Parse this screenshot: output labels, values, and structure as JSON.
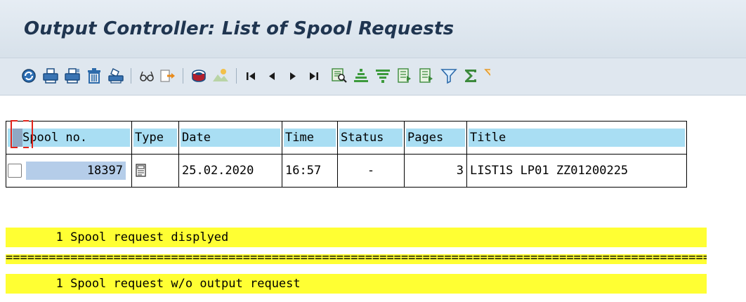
{
  "header": {
    "title": "Output Controller: List of Spool Requests"
  },
  "toolbar": {
    "buttons": [
      "refresh-icon",
      "print-icon",
      "print-with-changes-icon",
      "delete-icon",
      "print-directly-icon",
      "display-contents-icon",
      "output-requests-icon",
      "attributes-icon",
      "background-icon",
      "first-page-icon",
      "previous-page-icon",
      "next-page-icon",
      "last-page-icon",
      "find-icon",
      "sort-ascending-icon",
      "sort-descending-icon",
      "set-filter-icon",
      "select-layout-icon",
      "change-layout-icon",
      "filter-icon",
      "total-icon",
      "more-icon"
    ]
  },
  "table": {
    "columns": [
      "Spool no.",
      "Type",
      "Date",
      "Time",
      "Status",
      "Pages",
      "Title"
    ],
    "rows": [
      {
        "spool_no": "18397",
        "type_icon": "document-icon",
        "date": "25.02.2020",
        "time": "16:57",
        "status": "-",
        "pages": "3",
        "title": "LIST1S LP01 ZZ01200225"
      }
    ]
  },
  "messages": {
    "line1": "       1 Spool request displyed",
    "separator": "=====================================================================================================",
    "line2": "       1 Spool request w/o output request"
  },
  "colors": {
    "header_bg": "#a9def3",
    "selected_cell": "#b5cde9",
    "message_bg": "#ffff33",
    "title_color": "#1f3550"
  }
}
